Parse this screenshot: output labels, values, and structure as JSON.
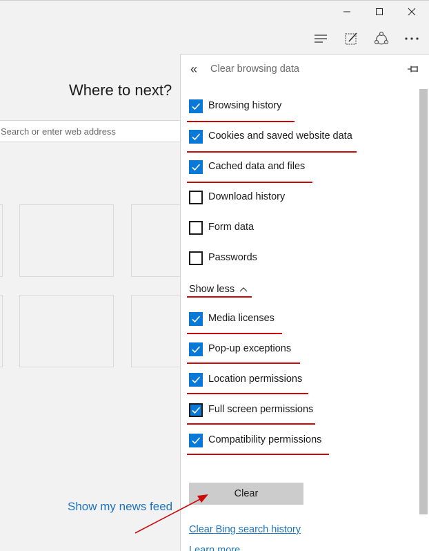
{
  "window": {
    "minimize_glyph": "—",
    "maximize_glyph": "☐",
    "close_glyph": "✕"
  },
  "toolbar": {
    "icons": [
      "hub-icon",
      "web-note-icon",
      "share-icon",
      "more-icon"
    ]
  },
  "new_tab": {
    "heading": "Where to next?",
    "search_placeholder": "Search or enter web address",
    "news_feed_link": "Show my news feed"
  },
  "panel": {
    "back_glyph": "«",
    "title": "Clear browsing data",
    "items": [
      {
        "label": "Browsing history",
        "checked": true
      },
      {
        "label": "Cookies and saved website data",
        "checked": true
      },
      {
        "label": "Cached data and files",
        "checked": true
      },
      {
        "label": "Download history",
        "checked": false
      },
      {
        "label": "Form data",
        "checked": false
      },
      {
        "label": "Passwords",
        "checked": false
      }
    ],
    "show_less": "Show less",
    "more_items": [
      {
        "label": "Media licenses",
        "checked": true
      },
      {
        "label": "Pop-up exceptions",
        "checked": true
      },
      {
        "label": "Location permissions",
        "checked": true
      },
      {
        "label": "Full screen permissions",
        "checked": true
      },
      {
        "label": "Compatibility permissions",
        "checked": true
      }
    ],
    "clear_button": "Clear",
    "bing_link": "Clear Bing search history",
    "learn_more": "Learn more"
  },
  "colors": {
    "accent": "#0a78d7",
    "annotation": "#cc0a0a",
    "link": "#1e73c0"
  }
}
